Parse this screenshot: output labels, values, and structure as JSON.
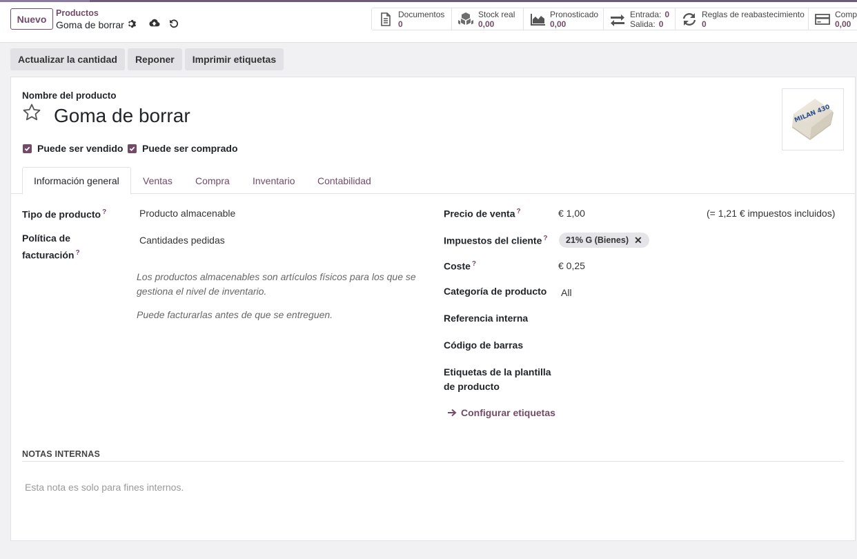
{
  "control_panel": {
    "new_button": "Nuevo",
    "breadcrumb_parent": "Productos",
    "breadcrumb_current": "Goma de borrar"
  },
  "stats": {
    "documents": {
      "label": "Documentos",
      "value": "0"
    },
    "stock": {
      "label": "Stock real",
      "value": "0,00"
    },
    "forecast": {
      "label": "Pronosticado",
      "value": "0,00"
    },
    "moves": {
      "in_label": "Entrada:",
      "in_value": "0",
      "out_label": "Salida:",
      "out_value": "0"
    },
    "reorder": {
      "label": "Reglas de reabastecimiento",
      "value": "0"
    },
    "purchased": {
      "label": "Compr",
      "value": "0,00"
    }
  },
  "actions": [
    "Actualizar la cantidad",
    "Reponer",
    "Imprimir etiquetas"
  ],
  "product": {
    "name_label": "Nombre del producto",
    "name": "Goma de borrar",
    "can_be_sold": "Puede ser vendido",
    "can_be_purchased": "Puede ser comprado",
    "image_text": "MILAN 430"
  },
  "tabs": [
    "Información general",
    "Ventas",
    "Compra",
    "Inventario",
    "Contabilidad"
  ],
  "general": {
    "product_type_label": "Tipo de producto",
    "product_type": "Producto almacenable",
    "invoice_policy_label_1": "Política de",
    "invoice_policy_label_2": "facturación",
    "invoice_policy": "Cantidades pedidas",
    "hint_1a": "Los productos almacenables son artículos físicos para los que se",
    "hint_1b": "gestiona el nivel de inventario.",
    "hint_2": "Puede facturarlas antes de que se entreguen.",
    "sale_price_label": "Precio de venta",
    "sale_price": "€ 1,00",
    "sale_price_taxed": "(= 1,21 € impuestos incluidos)",
    "customer_taxes_label": "Impuestos del cliente",
    "customer_tax": "21% G (Bienes)",
    "cost_label": "Coste",
    "cost": "€ 0,25",
    "category_label": "Categoría de producto",
    "category": "All",
    "internal_ref_label": "Referencia interna",
    "barcode_label": "Código de barras",
    "tags_label_1": "Etiquetas de la plantilla",
    "tags_label_2": "de producto",
    "configure_tags": "Configurar etiquetas",
    "tooltip_mark": "?"
  },
  "notes": {
    "header": "NOTAS INTERNAS",
    "placeholder": "Esta nota es solo para fines internos."
  },
  "colors": {
    "accent": "#714b67"
  }
}
